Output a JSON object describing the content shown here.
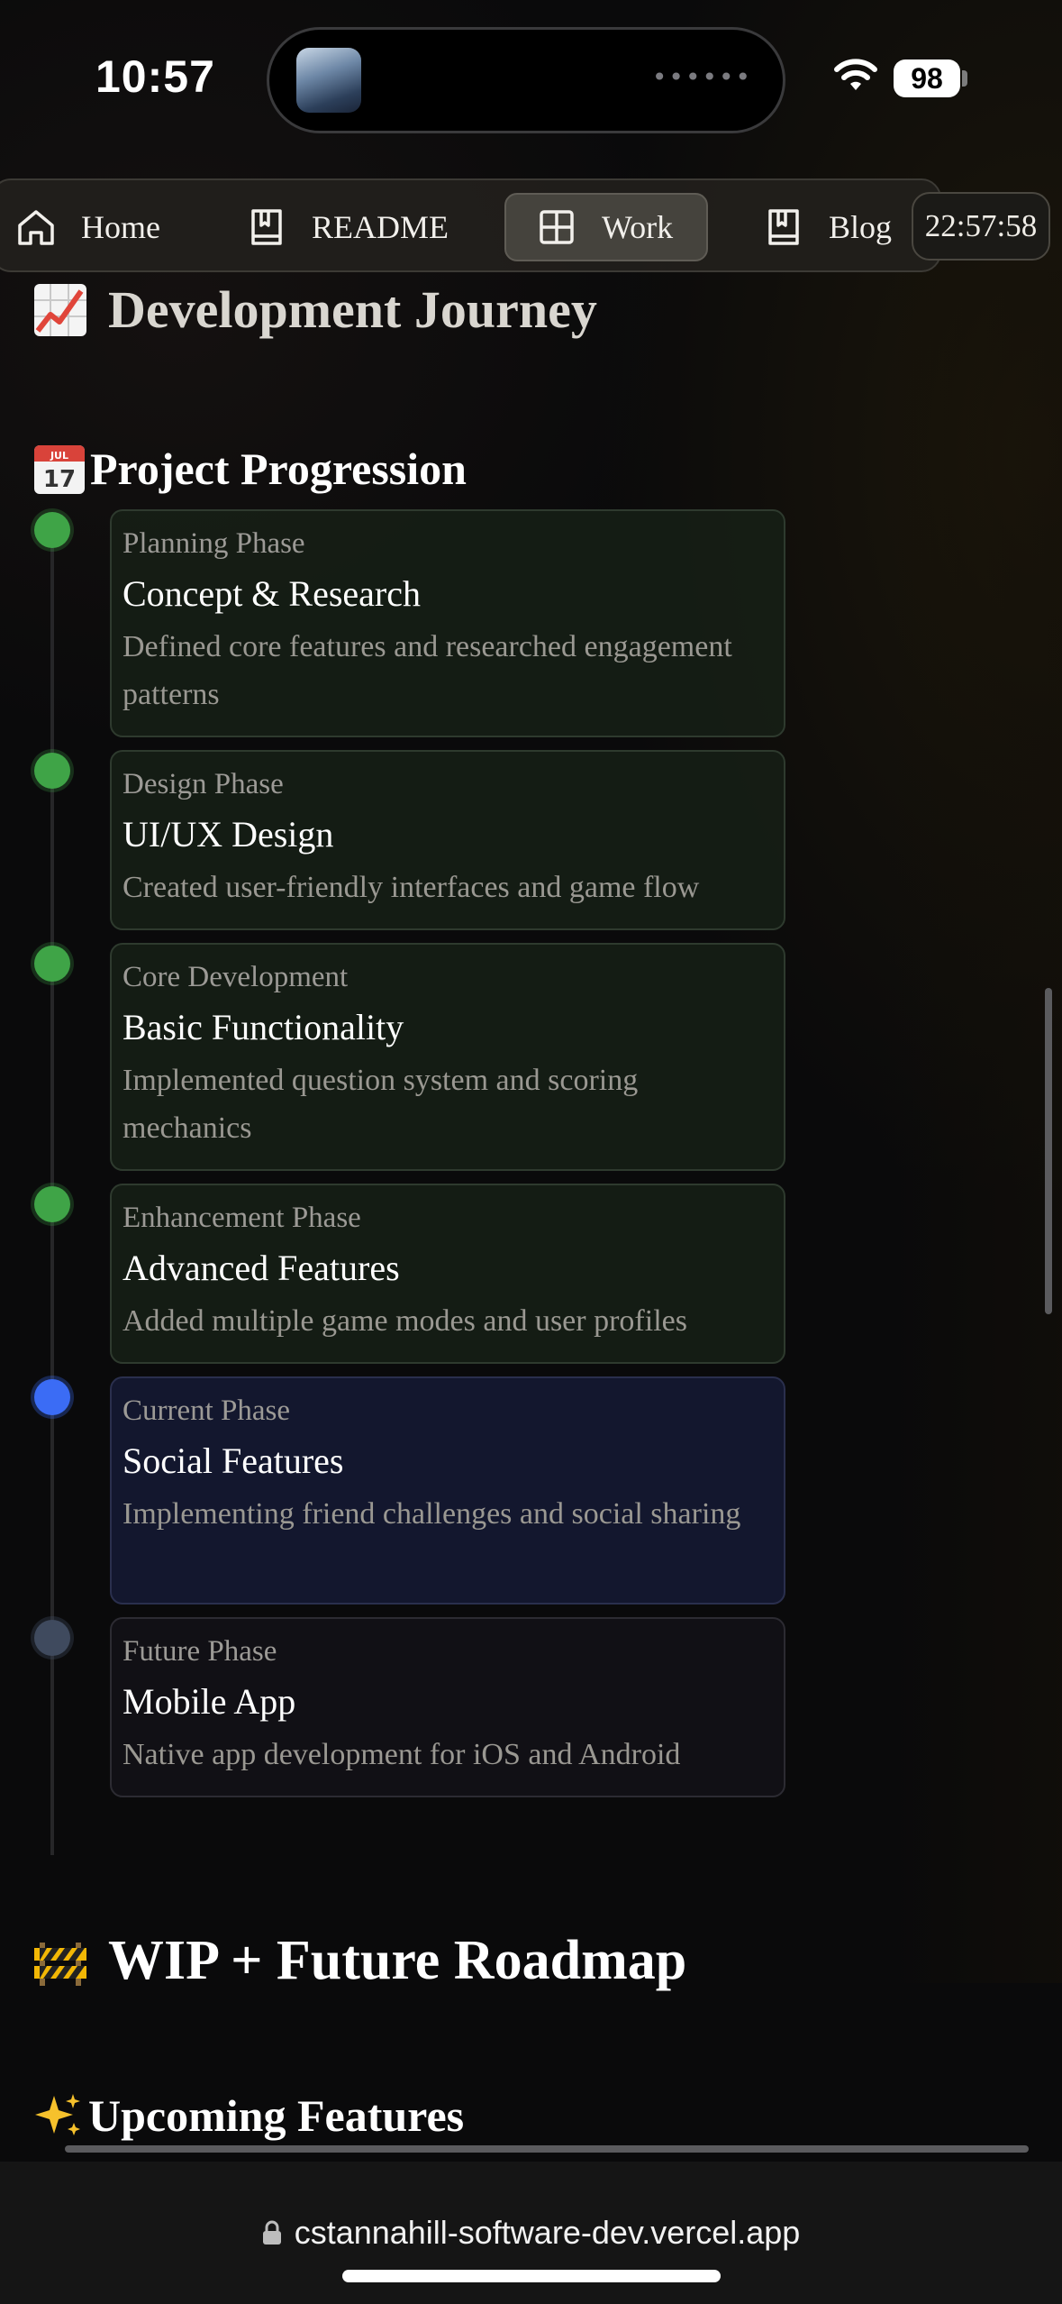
{
  "status_bar": {
    "time": "10:57",
    "battery": "98"
  },
  "nav": {
    "items": [
      {
        "label": "Home",
        "icon": "home-icon"
      },
      {
        "label": "README",
        "icon": "book-icon"
      },
      {
        "label": "Work",
        "icon": "grid-icon",
        "active": true
      },
      {
        "label": "Blog",
        "icon": "book-icon"
      }
    ],
    "clock": "22:57:58"
  },
  "section": {
    "title": "Development Journey",
    "title_icon": "chart-increasing-emoji",
    "subtitle": "Project Progression",
    "subtitle_icon": "calendar-emoji"
  },
  "timeline": [
    {
      "phase": "Planning Phase",
      "title": "Concept & Research",
      "desc": "Defined core features and researched engagement patterns",
      "status": "done"
    },
    {
      "phase": "Design Phase",
      "title": "UI/UX Design",
      "desc": "Created user-friendly interfaces and game flow",
      "status": "done"
    },
    {
      "phase": "Core Development",
      "title": "Basic Functionality",
      "desc": "Implemented question system and scoring mechanics",
      "status": "done"
    },
    {
      "phase": "Enhancement Phase",
      "title": "Advanced Features",
      "desc": "Added multiple game modes and user profiles",
      "status": "done"
    },
    {
      "phase": "Current Phase",
      "title": "Social Features",
      "desc": "Implementing friend challenges and social sharing",
      "status": "current"
    },
    {
      "phase": "Future Phase",
      "title": "Mobile App",
      "desc": "Native app development for iOS and Android",
      "status": "future"
    }
  ],
  "roadmap": {
    "title": "WIP + Future Roadmap",
    "title_icon": "construction-emoji",
    "subtitle": "Upcoming Features",
    "subtitle_icon": "sparkles-emoji"
  },
  "browser": {
    "url": "cstannahill-software-dev.vercel.app"
  },
  "colors": {
    "done": "#3fa447",
    "current": "#3b6cf5",
    "future": "#3f4a5e"
  }
}
